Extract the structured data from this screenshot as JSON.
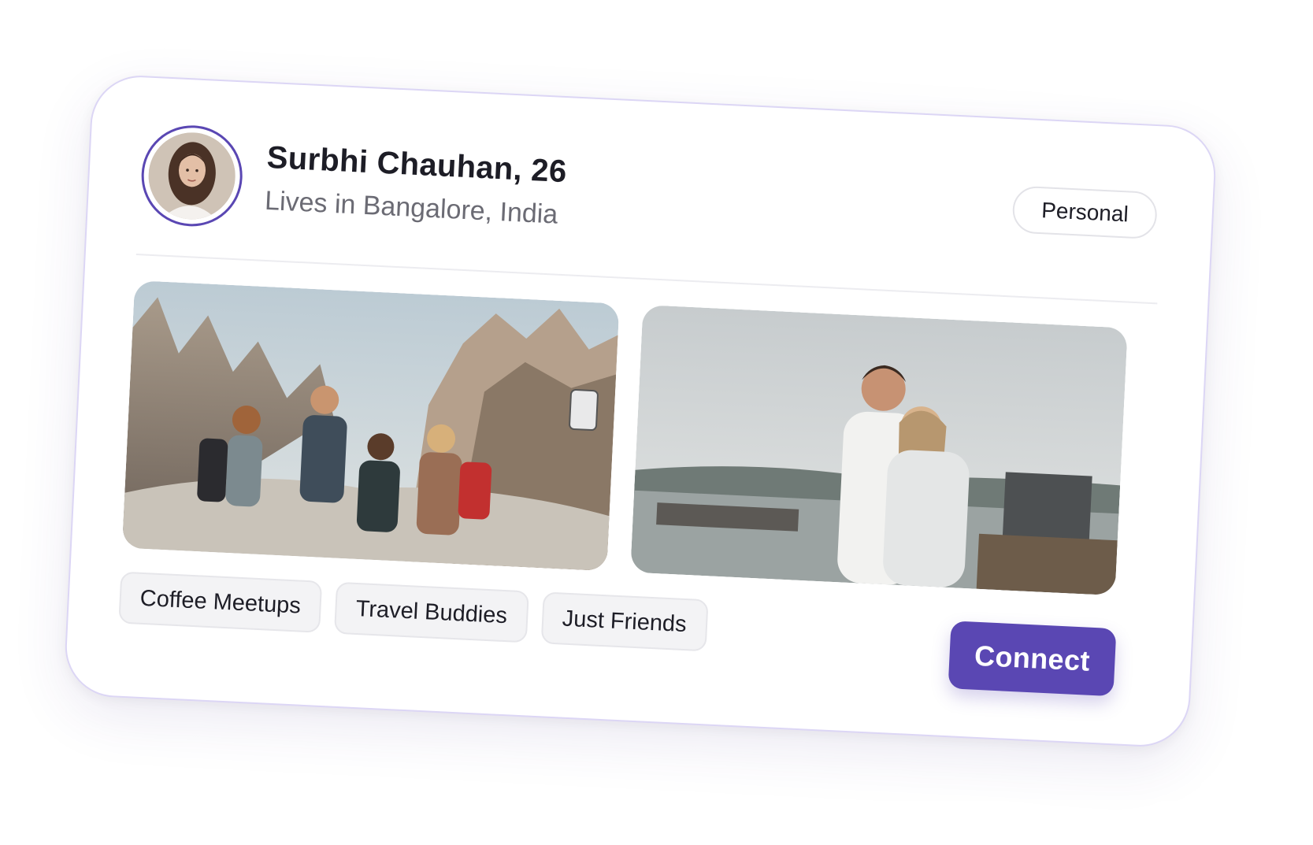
{
  "profile": {
    "name": "Surbhi Chauhan, 26",
    "location": "Lives in Bangalore, India",
    "category": "Personal"
  },
  "photos": [
    {
      "icon": "mountain-friends-photo"
    },
    {
      "icon": "couple-hug-photo"
    }
  ],
  "tags": [
    "Coffee Meetups",
    "Travel Buddies",
    "Just Friends"
  ],
  "actions": {
    "connect_label": "Connect"
  },
  "colors": {
    "accent": "#5a47b3",
    "card_border": "#dcd6f5",
    "tag_bg": "#f3f3f5",
    "text_primary": "#1d1d26",
    "text_secondary": "#6b6b74"
  }
}
